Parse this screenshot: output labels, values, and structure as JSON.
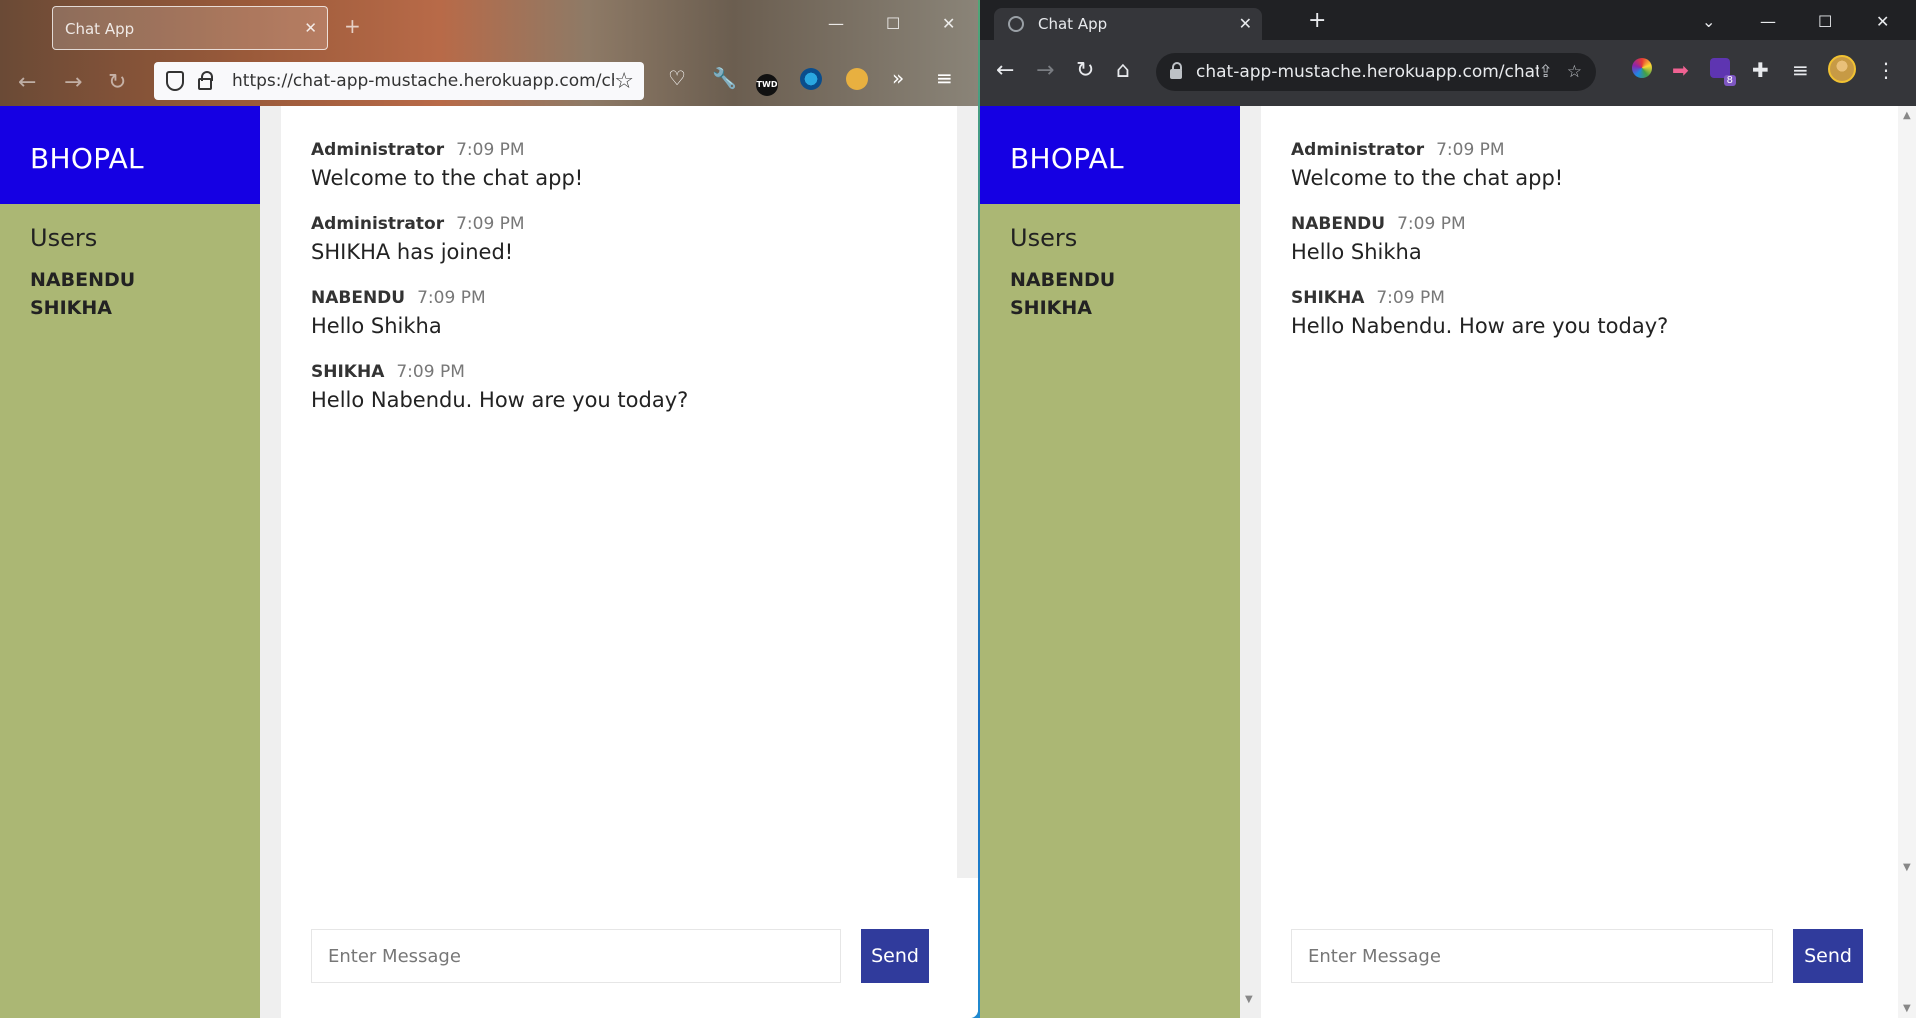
{
  "firefox": {
    "tab_title": "Chat App",
    "url": "https://chat-app-mustache.herokuapp.com/chat.h",
    "ext_label": "TWD"
  },
  "chrome": {
    "tab_title": "Chat App",
    "url": "chat-app-mustache.herokuapp.com/chat....",
    "ext_badge": "8"
  },
  "room": "BHOPAL",
  "users_title": "Users",
  "users": [
    "NABENDU",
    "SHIKHA"
  ],
  "firefox_messages": [
    {
      "name": "Administrator",
      "time": "7:09 PM",
      "text": "Welcome to the chat app!"
    },
    {
      "name": "Administrator",
      "time": "7:09 PM",
      "text": "SHIKHA has joined!"
    },
    {
      "name": "NABENDU",
      "time": "7:09 PM",
      "text": "Hello Shikha"
    },
    {
      "name": "SHIKHA",
      "time": "7:09 PM",
      "text": "Hello Nabendu. How are you today?"
    }
  ],
  "chrome_messages": [
    {
      "name": "Administrator",
      "time": "7:09 PM",
      "text": "Welcome to the chat app!"
    },
    {
      "name": "NABENDU",
      "time": "7:09 PM",
      "text": "Hello Shikha"
    },
    {
      "name": "SHIKHA",
      "time": "7:09 PM",
      "text": "Hello Nabendu. How are you today?"
    }
  ],
  "compose": {
    "placeholder": "Enter Message",
    "send_label": "Send"
  },
  "colors": {
    "sidebar_header": "#1500e3",
    "sidebar": "#abb774",
    "send_button": "#303b9c"
  }
}
